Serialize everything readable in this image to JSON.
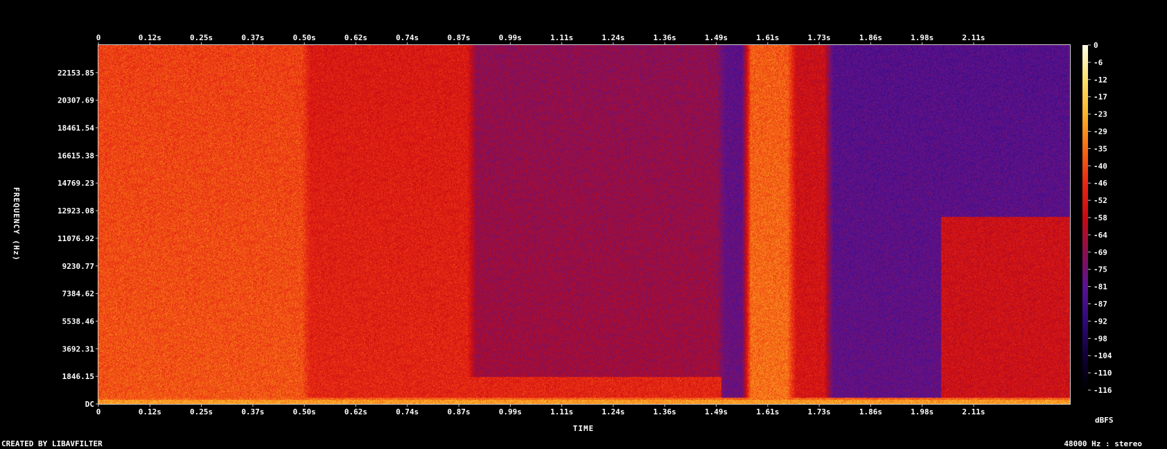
{
  "footer": {
    "created_by": "CREATED BY LIBAVFILTER",
    "sample_info": "48000 Hz : stereo"
  },
  "chart_data": {
    "type": "heatmap",
    "title": "",
    "xlabel": "TIME",
    "ylabel": "FREQUENCY (Hz)",
    "colorbar_label": "dBFS",
    "x_ticks": [
      "0",
      "0.12s",
      "0.25s",
      "0.37s",
      "0.50s",
      "0.62s",
      "0.74s",
      "0.87s",
      "0.99s",
      "1.11s",
      "1.24s",
      "1.36s",
      "1.49s",
      "1.61s",
      "1.73s",
      "1.86s",
      "1.98s",
      "2.11s"
    ],
    "x_tick_values": [
      0,
      0.124,
      0.248,
      0.372,
      0.496,
      0.62,
      0.744,
      0.868,
      0.992,
      1.116,
      1.24,
      1.364,
      1.488,
      1.612,
      1.736,
      1.86,
      1.984,
      2.108
    ],
    "xlim": [
      0,
      2.34
    ],
    "y_ticks": [
      "DC",
      "1846.15",
      "3692.31",
      "5538.46",
      "7384.62",
      "9230.77",
      "11076.92",
      "12923.08",
      "14769.23",
      "16615.38",
      "18461.54",
      "20307.69",
      "22153.85"
    ],
    "y_tick_values": [
      0,
      1846.15,
      3692.31,
      5538.46,
      7384.62,
      9230.77,
      11076.92,
      12923.08,
      14769.23,
      16615.38,
      18461.54,
      20307.69,
      22153.85
    ],
    "ylim": [
      0,
      24000
    ],
    "colorbar_ticks": [
      "0",
      "-6",
      "-12",
      "-17",
      "-23",
      "-29",
      "-35",
      "-40",
      "-46",
      "-52",
      "-58",
      "-64",
      "-69",
      "-75",
      "-81",
      "-87",
      "-92",
      "-98",
      "-104",
      "-110",
      "-116"
    ],
    "colorbar_values": [
      0,
      -6,
      -12,
      -17,
      -23,
      -29,
      -35,
      -40,
      -46,
      -52,
      -58,
      -64,
      -69,
      -75,
      -81,
      -87,
      -92,
      -98,
      -104,
      -110,
      -116
    ],
    "zlim": [
      -120,
      0
    ],
    "colormap": [
      "#000000",
      "#11003a",
      "#2e0a78",
      "#5a1295",
      "#8a1050",
      "#c80a12",
      "#e82814",
      "#f66a14",
      "#fbb42a",
      "#fde26c",
      "#fffde8"
    ],
    "energy_regions": [
      {
        "t": [
          0,
          0.5
        ],
        "f": [
          0,
          24000
        ],
        "db": -40
      },
      {
        "t": [
          0.5,
          0.9
        ],
        "f": [
          0,
          24000
        ],
        "db": -50
      },
      {
        "t": [
          0.9,
          1.5
        ],
        "f": [
          0,
          24000
        ],
        "db": -68
      },
      {
        "t": [
          1.5,
          1.56
        ],
        "f": [
          0,
          24000
        ],
        "db": -80
      },
      {
        "t": [
          1.56,
          1.67
        ],
        "f": [
          0,
          24000
        ],
        "db": -35
      },
      {
        "t": [
          1.67,
          1.76
        ],
        "f": [
          0,
          24000
        ],
        "db": -55
      },
      {
        "t": [
          1.76,
          2.34
        ],
        "f": [
          0,
          24000
        ],
        "db": -82
      },
      {
        "t": [
          2.03,
          2.34
        ],
        "f": [
          0,
          12500
        ],
        "db": -58
      },
      {
        "t": [
          0,
          2.34
        ],
        "f": [
          0,
          300
        ],
        "db": -28
      }
    ]
  }
}
